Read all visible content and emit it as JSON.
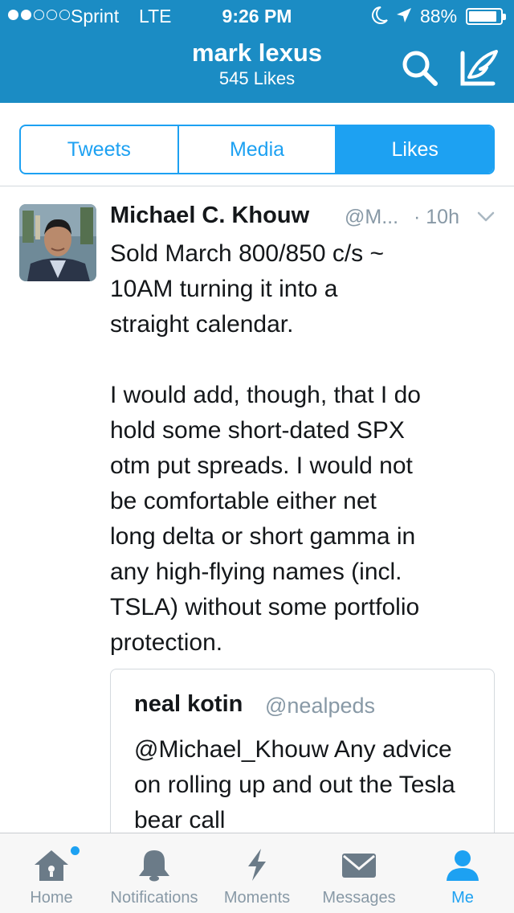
{
  "status_bar": {
    "carrier": "Sprint",
    "network": "LTE",
    "time": "9:26 PM",
    "battery": "88%",
    "signal_strength_of_5": 2,
    "icons": [
      "moon-icon",
      "location-arrow-icon",
      "battery-icon"
    ]
  },
  "header": {
    "name": "mark lexus",
    "subtitle": "545 Likes",
    "icons": [
      "search-icon",
      "compose-icon"
    ],
    "color": "#1b8cc4"
  },
  "tabs": [
    {
      "label": "Tweets",
      "active": false
    },
    {
      "label": "Media",
      "active": false
    },
    {
      "label": "Likes",
      "active": true
    }
  ],
  "tweet": {
    "name": "Michael C. Khouw",
    "handle": "@M...",
    "time": "· 10h",
    "body": "Sold March 800/850 c/s ~\n10AM  turning it into a\nstraight calendar.\n\nI would add, though, that I do\nhold some short-dated SPX\notm put spreads. I would not\nbe comfortable either net\nlong delta or short gamma in\nany high-flying names (incl.\nTSLA) without some portfolio\nprotection.",
    "quoted": {
      "name": "neal kotin",
      "handle": "@nealpeds",
      "body": "@Michael_Khouw Any advice on rolling up and out the Tesla bear call"
    }
  },
  "tabbar": {
    "items": [
      {
        "label": "Home",
        "icon": "home-icon",
        "active": false,
        "badge": true
      },
      {
        "label": "Notifications",
        "icon": "bell-icon",
        "active": false
      },
      {
        "label": "Moments",
        "icon": "lightning-icon",
        "active": false
      },
      {
        "label": "Messages",
        "icon": "envelope-icon",
        "active": false
      },
      {
        "label": "Me",
        "icon": "person-icon",
        "active": true
      }
    ]
  },
  "colors": {
    "accent": "#1da1f2",
    "muted": "#8899a6",
    "text": "#14171a"
  }
}
